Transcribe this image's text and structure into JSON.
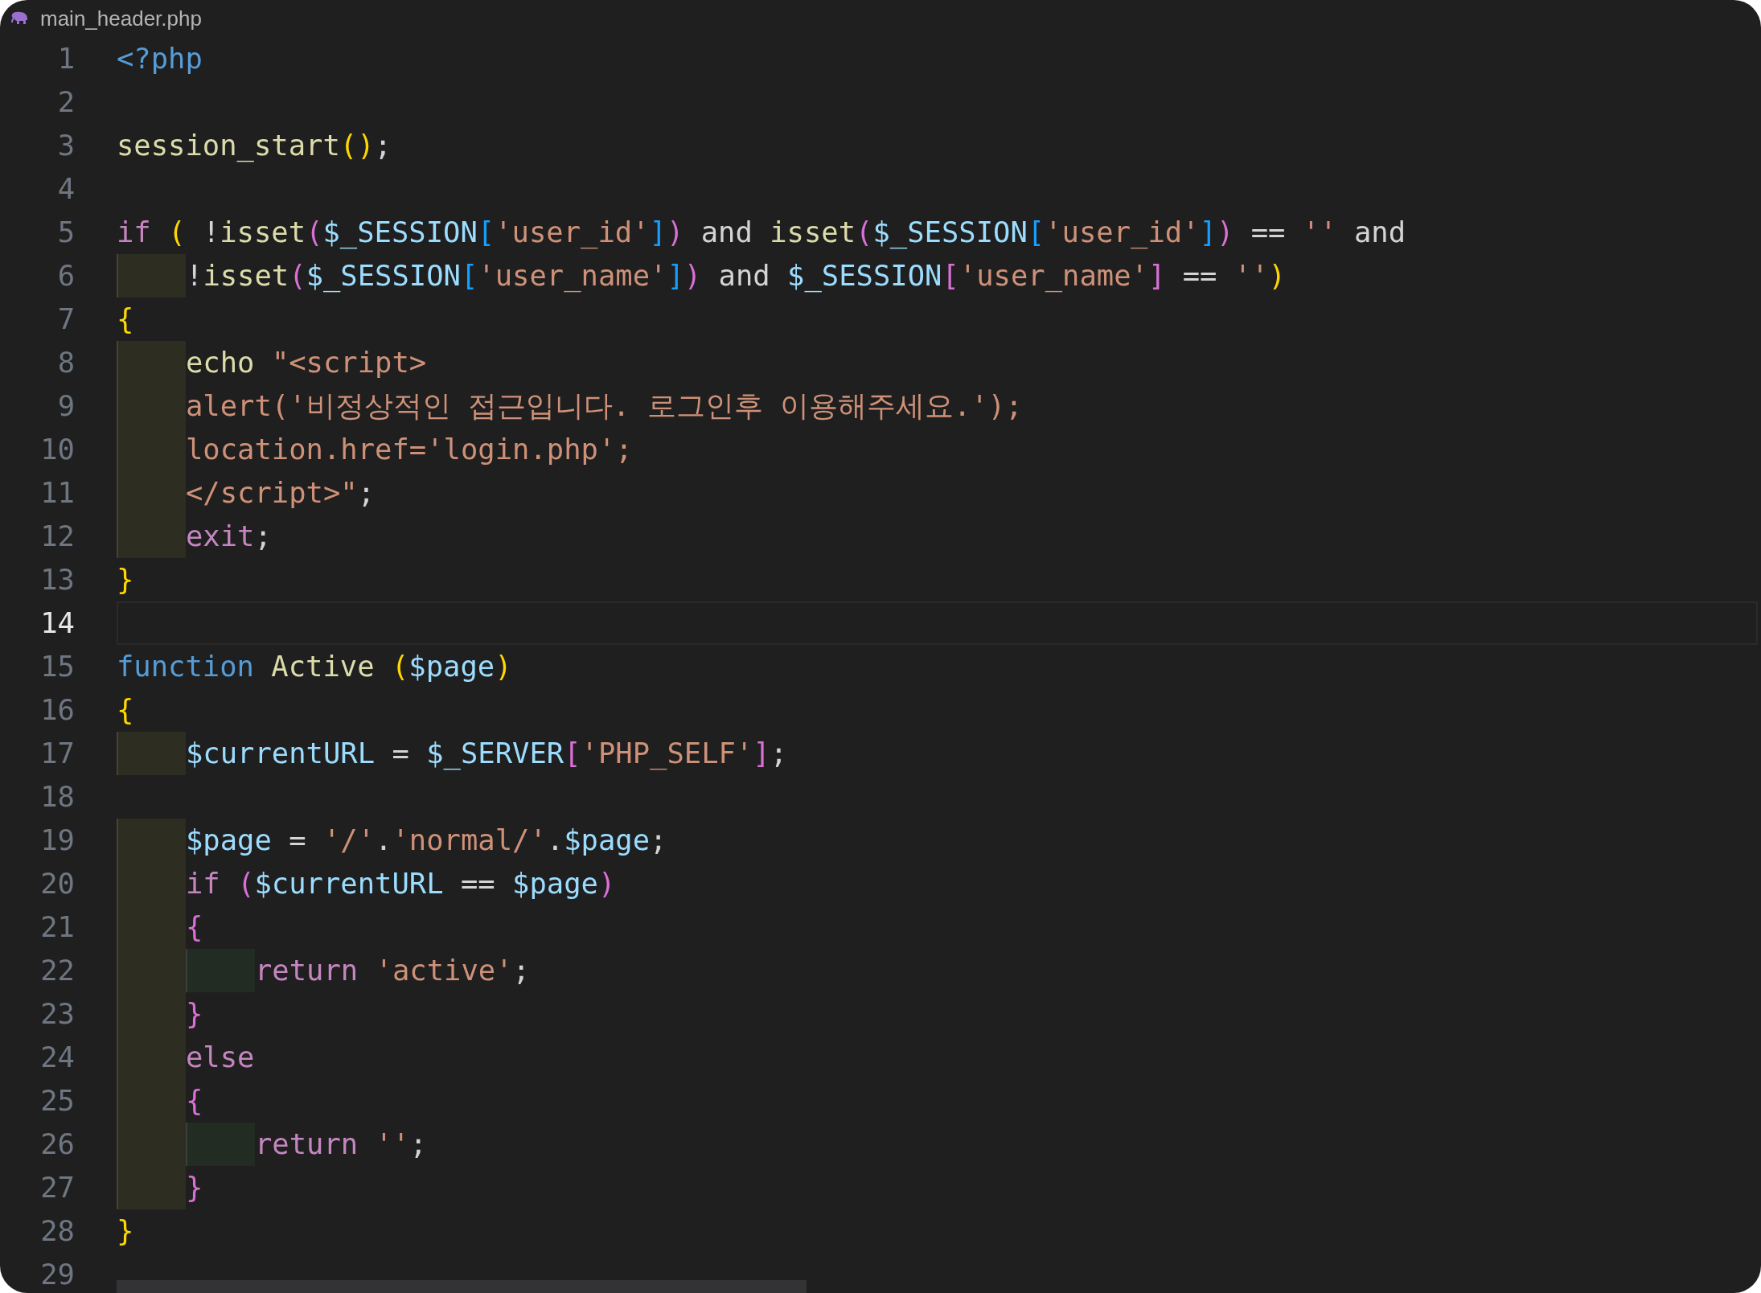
{
  "tab": {
    "filename": "main_header.php"
  },
  "lines": [
    {
      "number": "1",
      "current": false,
      "tokens": [
        {
          "kind": "tag",
          "text": "<?php"
        }
      ]
    },
    {
      "number": "2",
      "current": false
    },
    {
      "number": "3",
      "current": false,
      "tokens": [
        {
          "kind": "fn",
          "text": "session_start"
        },
        {
          "kind": "b1",
          "text": "()"
        },
        {
          "kind": "plain",
          "text": ";"
        }
      ]
    },
    {
      "number": "4",
      "current": false
    },
    {
      "number": "5",
      "current": false,
      "tokens": [
        {
          "kind": "kw",
          "text": "if "
        },
        {
          "kind": "b1",
          "text": "( "
        },
        {
          "kind": "plain",
          "text": "!"
        },
        {
          "kind": "fn",
          "text": "isset"
        },
        {
          "kind": "b2",
          "text": "("
        },
        {
          "kind": "var",
          "text": "$_SESSION"
        },
        {
          "kind": "b3",
          "text": "["
        },
        {
          "kind": "str",
          "text": "'user_id'"
        },
        {
          "kind": "b3",
          "text": "]"
        },
        {
          "kind": "b2",
          "text": ")"
        },
        {
          "kind": "plain",
          "text": " and "
        },
        {
          "kind": "fn",
          "text": "isset"
        },
        {
          "kind": "b2",
          "text": "("
        },
        {
          "kind": "var",
          "text": "$_SESSION"
        },
        {
          "kind": "b3",
          "text": "["
        },
        {
          "kind": "str",
          "text": "'user_id'"
        },
        {
          "kind": "b3",
          "text": "]"
        },
        {
          "kind": "b2",
          "text": ")"
        },
        {
          "kind": "plain",
          "text": " == "
        },
        {
          "kind": "str",
          "text": "''"
        },
        {
          "kind": "plain",
          "text": " and"
        }
      ]
    },
    {
      "number": "6",
      "current": false,
      "guides": [
        {
          "kind": "outer"
        }
      ],
      "tokens": [
        {
          "kind": "plain",
          "text": "!"
        },
        {
          "kind": "fn",
          "text": "isset"
        },
        {
          "kind": "b2",
          "text": "("
        },
        {
          "kind": "var",
          "text": "$_SESSION"
        },
        {
          "kind": "b3",
          "text": "["
        },
        {
          "kind": "str",
          "text": "'user_name'"
        },
        {
          "kind": "b3",
          "text": "]"
        },
        {
          "kind": "b2",
          "text": ")"
        },
        {
          "kind": "plain",
          "text": " and "
        },
        {
          "kind": "var",
          "text": "$_SESSION"
        },
        {
          "kind": "b2",
          "text": "["
        },
        {
          "kind": "str",
          "text": "'user_name'"
        },
        {
          "kind": "b2",
          "text": "]"
        },
        {
          "kind": "plain",
          "text": " == "
        },
        {
          "kind": "str",
          "text": "''"
        },
        {
          "kind": "b1",
          "text": ")"
        }
      ]
    },
    {
      "number": "7",
      "current": false,
      "tokens": [
        {
          "kind": "b1",
          "text": "{"
        }
      ]
    },
    {
      "number": "8",
      "current": false,
      "guides": [
        {
          "kind": "outer"
        }
      ],
      "tokens": [
        {
          "kind": "fn",
          "text": "echo "
        },
        {
          "kind": "str",
          "text": "\"<script>"
        }
      ]
    },
    {
      "number": "9",
      "current": false,
      "guides": [
        {
          "kind": "outer"
        }
      ],
      "tokens": [
        {
          "kind": "str",
          "text": "alert('비정상적인 접근입니다. 로그인후 이용해주세요.');"
        }
      ]
    },
    {
      "number": "10",
      "current": false,
      "guides": [
        {
          "kind": "outer"
        }
      ],
      "tokens": [
        {
          "kind": "str",
          "text": "location.href='login.php';"
        }
      ]
    },
    {
      "number": "11",
      "current": false,
      "guides": [
        {
          "kind": "outer"
        }
      ],
      "tokens": [
        {
          "kind": "str",
          "text": "</script>\""
        },
        {
          "kind": "plain",
          "text": ";"
        }
      ]
    },
    {
      "number": "12",
      "current": false,
      "guides": [
        {
          "kind": "outer"
        }
      ],
      "tokens": [
        {
          "kind": "kw",
          "text": "exit"
        },
        {
          "kind": "plain",
          "text": ";"
        }
      ]
    },
    {
      "number": "13",
      "current": false,
      "tokens": [
        {
          "kind": "b1",
          "text": "}"
        }
      ]
    },
    {
      "number": "14",
      "current": true
    },
    {
      "number": "15",
      "current": false,
      "tokens": [
        {
          "kind": "storage",
          "text": "function "
        },
        {
          "kind": "fn",
          "text": "Active "
        },
        {
          "kind": "b1",
          "text": "("
        },
        {
          "kind": "var",
          "text": "$page"
        },
        {
          "kind": "b1",
          "text": ")"
        }
      ]
    },
    {
      "number": "16",
      "current": false,
      "tokens": [
        {
          "kind": "b1",
          "text": "{"
        }
      ]
    },
    {
      "number": "17",
      "current": false,
      "guides": [
        {
          "kind": "outer"
        }
      ],
      "tokens": [
        {
          "kind": "var",
          "text": "$currentURL"
        },
        {
          "kind": "plain",
          "text": " = "
        },
        {
          "kind": "var",
          "text": "$_SERVER"
        },
        {
          "kind": "b2",
          "text": "["
        },
        {
          "kind": "str",
          "text": "'PHP_SELF'"
        },
        {
          "kind": "b2",
          "text": "]"
        },
        {
          "kind": "plain",
          "text": ";"
        }
      ]
    },
    {
      "number": "18",
      "current": false
    },
    {
      "number": "19",
      "current": false,
      "guides": [
        {
          "kind": "outer"
        }
      ],
      "tokens": [
        {
          "kind": "var",
          "text": "$page"
        },
        {
          "kind": "plain",
          "text": " = "
        },
        {
          "kind": "str",
          "text": "'/'"
        },
        {
          "kind": "plain",
          "text": "."
        },
        {
          "kind": "str",
          "text": "'normal/'"
        },
        {
          "kind": "plain",
          "text": "."
        },
        {
          "kind": "var",
          "text": "$page"
        },
        {
          "kind": "plain",
          "text": ";"
        }
      ]
    },
    {
      "number": "20",
      "current": false,
      "guides": [
        {
          "kind": "outer"
        }
      ],
      "tokens": [
        {
          "kind": "kw",
          "text": "if "
        },
        {
          "kind": "b2",
          "text": "("
        },
        {
          "kind": "var",
          "text": "$currentURL"
        },
        {
          "kind": "plain",
          "text": " == "
        },
        {
          "kind": "var",
          "text": "$page"
        },
        {
          "kind": "b2",
          "text": ")"
        }
      ]
    },
    {
      "number": "21",
      "current": false,
      "guides": [
        {
          "kind": "outer"
        }
      ],
      "tokens": [
        {
          "kind": "b2",
          "text": "{"
        }
      ]
    },
    {
      "number": "22",
      "current": false,
      "guides": [
        {
          "kind": "outer"
        },
        {
          "kind": "inner"
        }
      ],
      "tokens": [
        {
          "kind": "kw",
          "text": "return "
        },
        {
          "kind": "str",
          "text": "'active'"
        },
        {
          "kind": "plain",
          "text": ";"
        }
      ]
    },
    {
      "number": "23",
      "current": false,
      "guides": [
        {
          "kind": "outer"
        }
      ],
      "tokens": [
        {
          "kind": "b2",
          "text": "}"
        }
      ]
    },
    {
      "number": "24",
      "current": false,
      "guides": [
        {
          "kind": "outer"
        }
      ],
      "tokens": [
        {
          "kind": "kw",
          "text": "else"
        }
      ]
    },
    {
      "number": "25",
      "current": false,
      "guides": [
        {
          "kind": "outer"
        }
      ],
      "tokens": [
        {
          "kind": "b2",
          "text": "{"
        }
      ]
    },
    {
      "number": "26",
      "current": false,
      "guides": [
        {
          "kind": "outer"
        },
        {
          "kind": "inner"
        }
      ],
      "tokens": [
        {
          "kind": "kw",
          "text": "return "
        },
        {
          "kind": "str",
          "text": "''"
        },
        {
          "kind": "plain",
          "text": ";"
        }
      ]
    },
    {
      "number": "27",
      "current": false,
      "guides": [
        {
          "kind": "outer"
        }
      ],
      "tokens": [
        {
          "kind": "b2",
          "text": "}"
        }
      ]
    },
    {
      "number": "28",
      "current": false,
      "tokens": [
        {
          "kind": "b1",
          "text": "}"
        }
      ]
    },
    {
      "number": "29",
      "current": false
    }
  ]
}
